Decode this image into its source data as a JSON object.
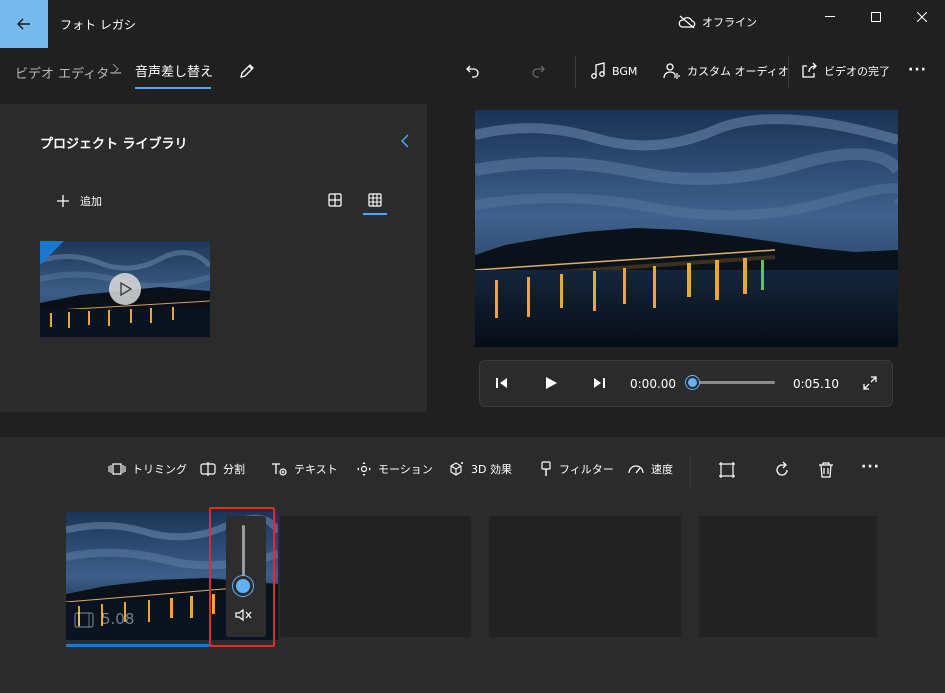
{
  "app": {
    "title": "フォト レガシ",
    "offline_label": "オフライン"
  },
  "breadcrumb": {
    "parent": "ビデオ エディター",
    "separator": ">",
    "current": "音声差し替え"
  },
  "toolbar": {
    "bgm": "BGM",
    "custom_audio": "カスタム オーディオ",
    "finish_video": "ビデオの完了",
    "more": "···"
  },
  "library": {
    "title": "プロジェクト ライブラリ",
    "add": "追加"
  },
  "player": {
    "current_time": "0:00.00",
    "end_time": "0:05.10",
    "seek_progress": 0
  },
  "storyboard": {
    "tools": [
      {
        "id": "trim",
        "label": "トリミング",
        "icon": "trim-icon"
      },
      {
        "id": "split",
        "label": "分割",
        "icon": "split-icon"
      },
      {
        "id": "text",
        "label": "テキスト",
        "icon": "text-icon"
      },
      {
        "id": "motion",
        "label": "モーション",
        "icon": "motion-icon"
      },
      {
        "id": "3d",
        "label": "3D 効果",
        "icon": "3d-effects-icon"
      },
      {
        "id": "filter",
        "label": "フィルター",
        "icon": "filter-icon"
      },
      {
        "id": "speed",
        "label": "速度",
        "icon": "speed-icon"
      }
    ],
    "more": "···",
    "clip": {
      "duration": "5.08"
    },
    "volume_level": 0.15
  },
  "colors": {
    "accent": "#4ca6ff",
    "back_button": "#76b9ed",
    "highlight": "#e02b2b"
  }
}
